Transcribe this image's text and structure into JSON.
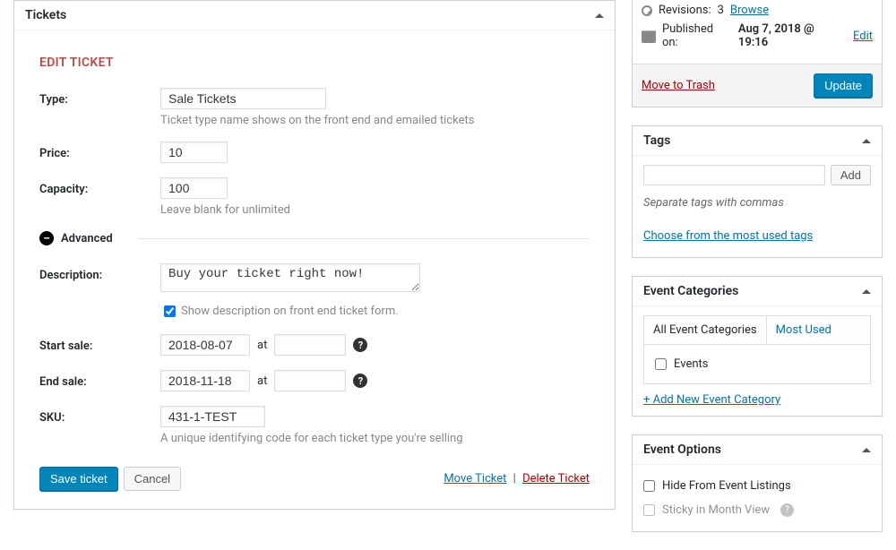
{
  "tickets_box": {
    "title": "Tickets",
    "edit_heading": "EDIT TICKET",
    "type": {
      "label": "Type:",
      "value": "Sale Tickets",
      "help": "Ticket type name shows on the front end and emailed tickets"
    },
    "price": {
      "label": "Price:",
      "value": "10"
    },
    "capacity": {
      "label": "Capacity:",
      "value": "100",
      "help": "Leave blank for unlimited"
    },
    "advanced_label": "Advanced",
    "description": {
      "label": "Description:",
      "value": "Buy your ticket right now!",
      "cb_checked": true,
      "cb_label": "Show description on front end ticket form."
    },
    "start_sale": {
      "label": "Start sale:",
      "date": "2018-08-07",
      "at": "at",
      "time": ""
    },
    "end_sale": {
      "label": "End sale:",
      "date": "2018-11-18",
      "at": "at",
      "time": ""
    },
    "sku": {
      "label": "SKU:",
      "value": "431-1-TEST",
      "help": "A unique identifying code for each ticket type you're selling"
    },
    "actions": {
      "save": "Save ticket",
      "cancel": "Cancel",
      "move": "Move Ticket",
      "delete": "Delete Ticket"
    }
  },
  "publish_box": {
    "revisions_prefix": "Revisions:",
    "revisions_count": "3",
    "browse": "Browse",
    "published_prefix": "Published on:",
    "published_value": "Aug 7, 2018 @ 19:16",
    "edit": "Edit",
    "trash": "Move to Trash",
    "update": "Update"
  },
  "tags_box": {
    "title": "Tags",
    "add": "Add",
    "note": "Separate tags with commas",
    "choose": "Choose from the most used tags"
  },
  "categories_box": {
    "title": "Event Categories",
    "tab_all": "All Event Categories",
    "tab_used": "Most Used",
    "item_events": "Events",
    "add_new": "+ Add New Event Category"
  },
  "options_box": {
    "title": "Event Options",
    "hide": "Hide From Event Listings",
    "sticky": "Sticky in Month View"
  }
}
